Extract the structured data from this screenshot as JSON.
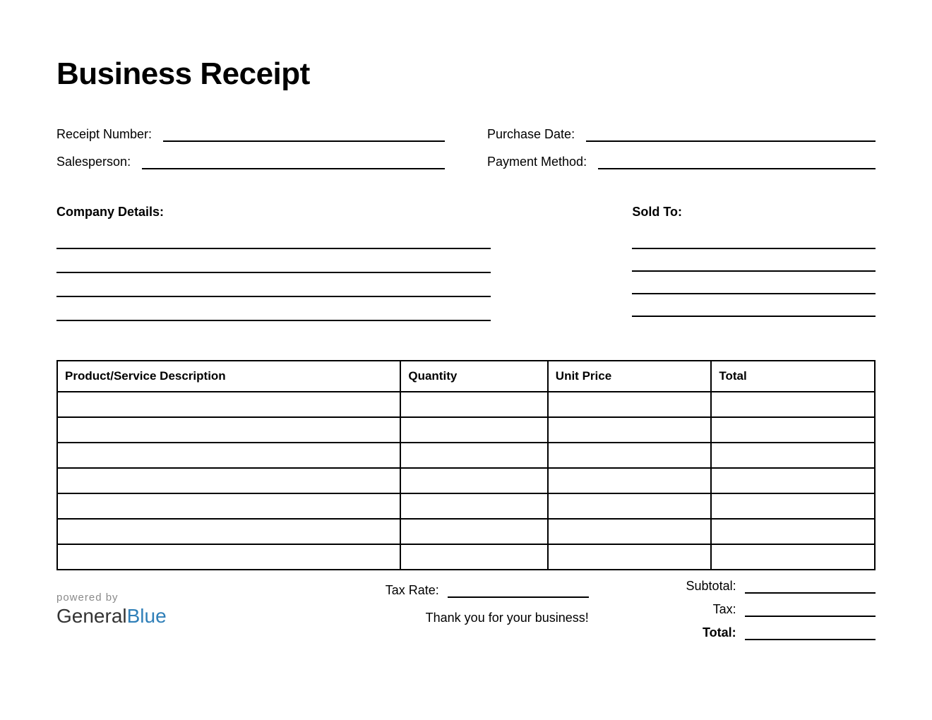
{
  "title": "Business Receipt",
  "meta": {
    "receipt_number_label": "Receipt Number:",
    "purchase_date_label": "Purchase Date:",
    "salesperson_label": "Salesperson:",
    "payment_method_label": "Payment Method:"
  },
  "sections": {
    "company_details_label": "Company Details:",
    "sold_to_label": "Sold To:"
  },
  "table": {
    "headers": {
      "description": "Product/Service Description",
      "quantity": "Quantity",
      "unit_price": "Unit Price",
      "total": "Total"
    }
  },
  "totals": {
    "subtotal_label": "Subtotal:",
    "tax_label": "Tax:",
    "total_label": "Total:"
  },
  "tax_rate_label": "Tax Rate:",
  "thanks": "Thank you for your business!",
  "brand": {
    "powered_by": "powered by",
    "name_part1": "General",
    "name_part2": "Blue"
  }
}
